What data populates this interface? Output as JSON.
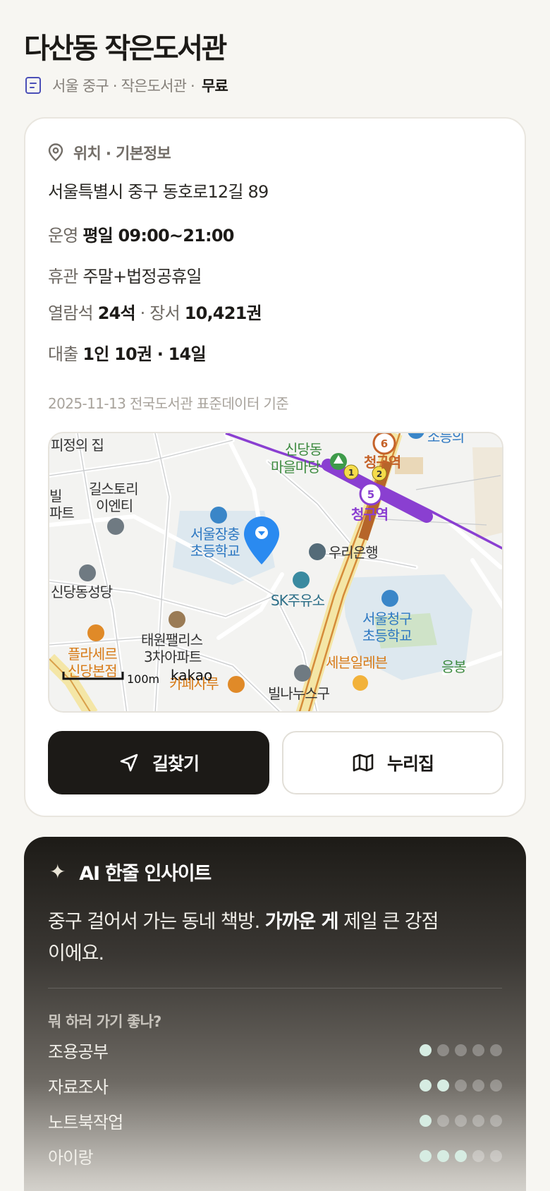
{
  "header": {
    "title": "다산동 작은도서관",
    "subtitle_info": "서울 중구 · 작은도서관 ·",
    "fee": "무료"
  },
  "info": {
    "section_title": "위치 · 기본정보",
    "address": "서울특별시 중구 동호로12길 89",
    "hours_label": "운영",
    "hours_value": "평일 09:00~21:00",
    "closed_label": "휴관",
    "closed_value": "주말+법정공휴일",
    "seats_label": "열람석",
    "seats_value": "24석",
    "books_label": "· 장서",
    "books_value": "10,421권",
    "loan_label": "대출",
    "loan_value": "1인 10권 · 14일",
    "source": "2025-11-13 전국도서관 표준데이터 기준"
  },
  "map": {
    "labels": {
      "p1": "피정의 집",
      "p2": "길스토리",
      "p2b": "이엔티",
      "p3": "빌",
      "p3b": "파트",
      "p4": "신당동",
      "p4b": "마을마당",
      "p5": "청구역",
      "p6": "청구역",
      "p7": "서울장충",
      "p7b": "초등학교",
      "p8": "우리은행",
      "p9": "신당동성당",
      "p10": "SK주유소",
      "p11": "서울청구",
      "p11b": "초등학교",
      "p12": "태원팰리스",
      "p12b": "3차아파트",
      "p13": "플라세르",
      "p13b": "신당본점",
      "p14": "세븐일레븐",
      "p15": "응봉",
      "p16": "카페사루",
      "p17": "빌나누스구",
      "p18": "소등의",
      "line_6": "6",
      "line_5": "5",
      "exit_1": "1",
      "exit_2": "2",
      "scale": "100m",
      "brand": "kakao"
    }
  },
  "buttons": {
    "directions": "길찾기",
    "website": "누리집"
  },
  "ai": {
    "title": "AI 한줄 인사이트",
    "text_before": "중구 걸어서 가는 동네 책방. ",
    "text_bold": "가까운 게",
    "text_after": " 제일 큰 강점이에요.",
    "question": "뭐 하러 가기 좋나?",
    "ratings": [
      {
        "label": "조용공부",
        "score": 1,
        "max": 5
      },
      {
        "label": "자료조사",
        "score": 2,
        "max": 5
      },
      {
        "label": "노트북작업",
        "score": 1,
        "max": 5
      },
      {
        "label": "아이랑",
        "score": 3,
        "max": 5
      }
    ]
  },
  "colors": {
    "accent_dark": "#1c1a17",
    "subway_line5": "#8a3fd1",
    "subway_line6": "#c5632a",
    "map_pin": "#2a8af0",
    "rating_on": "#d6ece2"
  }
}
